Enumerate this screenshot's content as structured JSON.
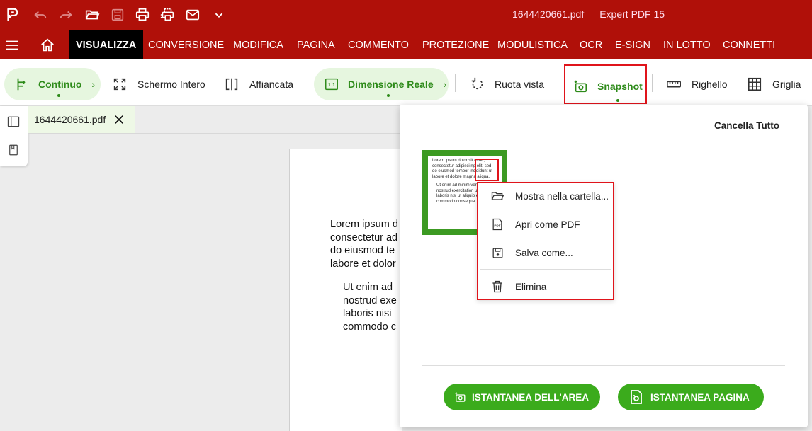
{
  "titlebar": {
    "filename": "1644420661.pdf",
    "app_name": "Expert PDF 15"
  },
  "menu": {
    "items": [
      "VISUALIZZA",
      "CONVERSIONE",
      "MODIFICA",
      "PAGINA",
      "COMMENTO",
      "PROTEZIONE",
      "MODULISTICA",
      "OCR",
      "E-SIGN",
      "IN LOTTO",
      "CONNETTI"
    ],
    "active": "VISUALIZZA"
  },
  "ribbon": {
    "continuo": "Continuo",
    "schermo_intero": "Schermo Intero",
    "affiancata": "Affiancata",
    "dimensione_reale": "Dimensione Reale",
    "ruota_vista": "Ruota vista",
    "snapshot": "Snapshot",
    "righello": "Righello",
    "griglia": "Griglia"
  },
  "document": {
    "tab_name": "1644420661.pdf",
    "para1": [
      "Lorem ipsum d",
      "consectetur ad",
      "do eiusmod te",
      "labore et dolor"
    ],
    "para2": [
      "Ut enim ad",
      "nostrud exe",
      "laboris nisi",
      "commodo c"
    ]
  },
  "snapshot_panel": {
    "clear_all": "Cancella Tutto",
    "thumb_lines1": [
      "Lorem ipsum dolor sit amet,",
      "consectetur adipisci ng elit, sed",
      "do eiusmod tempor incididunt ut",
      "labore et dolore magna aliqua."
    ],
    "thumb_lines2": [
      "Ut enim ad minim veniam, quis",
      "nostrud exercitation ullamco",
      "laboris nisi ut aliquip ex ea",
      "commodo consequat."
    ],
    "area_button": "ISTANTANEA DELL'AREA",
    "page_button": "ISTANTANEA PAGINA"
  },
  "context_menu": {
    "show_in_folder": "Mostra nella cartella...",
    "open_as_pdf": "Apri come PDF",
    "save_as": "Salva come...",
    "delete": "Elimina"
  },
  "colors": {
    "brand_red": "#b01009",
    "accent_green": "#3bab1c",
    "highlight_red": "#e0141b"
  }
}
